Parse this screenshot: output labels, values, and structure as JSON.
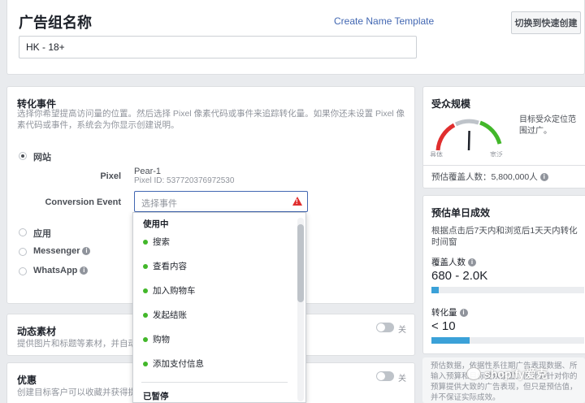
{
  "header": {
    "title": "广告组名称",
    "create_template": "Create Name Template",
    "quick_create": "切换到快速创建",
    "name_value": "HK - 18+"
  },
  "conversion": {
    "title": "转化事件",
    "description": "选择你希望提高访问量的位置。然后选择 Pixel 像素代码或事件来追踪转化量。如果你还未设置 Pixel 像素代码或事件，系统会为你显示创建说明。",
    "options": [
      "网站",
      "应用",
      "Messenger",
      "WhatsApp"
    ],
    "selected": "网站",
    "pixel_label": "Pixel",
    "pixel_name": "Pear-1",
    "pixel_id": "Pixel ID: 537720376972530",
    "event_label": "Conversion Event",
    "event_placeholder": "选择事件"
  },
  "dropdown": {
    "header": "使用中",
    "items": [
      "搜索",
      "查看内容",
      "加入购物车",
      "发起结账",
      "购物",
      "添加支付信息"
    ],
    "paused": "已暂停"
  },
  "dynamic": {
    "title": "动态素材",
    "desc": "提供图片和标题等素材，并自动为",
    "toggle": "关"
  },
  "offer": {
    "title": "优惠",
    "desc": "创建目标客户可以收藏并获得提醒",
    "toggle": "关"
  },
  "audience": {
    "title": "受众规模",
    "gauge_left": "具体",
    "gauge_right": "宽泛",
    "gauge_level": 0.62,
    "desc": "目标受众定位范围过广。",
    "reach": "预估覆盖人数：5,800,000人"
  },
  "estimate": {
    "title": "预估单日成效",
    "desc": "根据点击后7天内和浏览后1天天内转化时间窗",
    "reach_label": "覆盖人数",
    "reach_value": "680 - 2.0K",
    "reach_fill": 0.05,
    "conv_label": "转化量",
    "conv_value": "< 10",
    "conv_fill": 0.25
  },
  "note": {
    "text": "预估数据，依据性系往期广告表现数据、所输入预算和目标受众设置。因此会针对你的预算提供大致的广告表现，但只是预估值，并不保证实际成效。"
  },
  "watermark": "shopify爱克",
  "colors": {
    "accent": "#4267b2",
    "green": "#42b72a",
    "error": "#e02e2e",
    "bar": "#3ba1d8"
  }
}
